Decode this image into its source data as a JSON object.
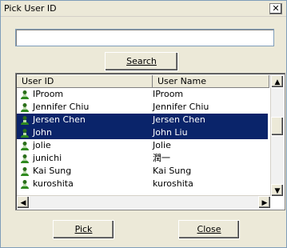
{
  "window": {
    "title": "Pick User ID",
    "close_glyph": "✕"
  },
  "search": {
    "input_value": "",
    "button_label": "Search"
  },
  "list": {
    "columns": [
      "User ID",
      "User Name"
    ],
    "rows": [
      {
        "id": "IProom",
        "name": "IProom",
        "selected": false
      },
      {
        "id": "Jennifer Chiu",
        "name": "Jennifer Chiu",
        "selected": false
      },
      {
        "id": "Jersen Chen",
        "name": "Jersen Chen",
        "selected": true
      },
      {
        "id": "John",
        "name": "John Liu",
        "selected": true
      },
      {
        "id": "jolie",
        "name": "Jolie",
        "selected": false
      },
      {
        "id": "junichi",
        "name": "潤一",
        "selected": false
      },
      {
        "id": "Kai Sung",
        "name": "Kai Sung",
        "selected": false
      },
      {
        "id": "kuroshita",
        "name": "kuroshita",
        "selected": false
      }
    ]
  },
  "buttons": {
    "pick": "Pick",
    "close": "Close"
  },
  "icons": {
    "row": "user-icon",
    "scroll_up": "scroll-up-icon",
    "scroll_down": "scroll-down-icon",
    "scroll_left": "scroll-left-icon",
    "scroll_right": "scroll-right-icon"
  },
  "colors": {
    "selection": "#0a246a"
  }
}
